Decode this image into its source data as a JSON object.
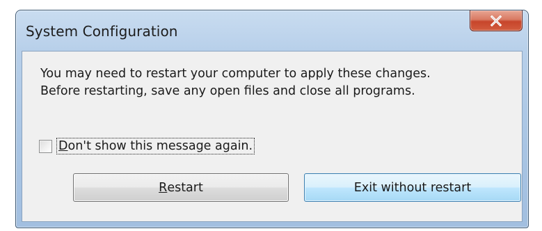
{
  "window": {
    "title": "System Configuration",
    "close_glyph": "X"
  },
  "message": {
    "line1": "You may need to restart your computer to apply these changes.",
    "line2": "Before restarting, save any open files and close all programs."
  },
  "checkbox": {
    "label_first": "D",
    "label_rest": "on't show this message again.",
    "checked": false
  },
  "buttons": {
    "restart_first": "R",
    "restart_rest": "estart",
    "exit_label": "Exit without restart"
  },
  "icons": {
    "close": "close-icon"
  }
}
